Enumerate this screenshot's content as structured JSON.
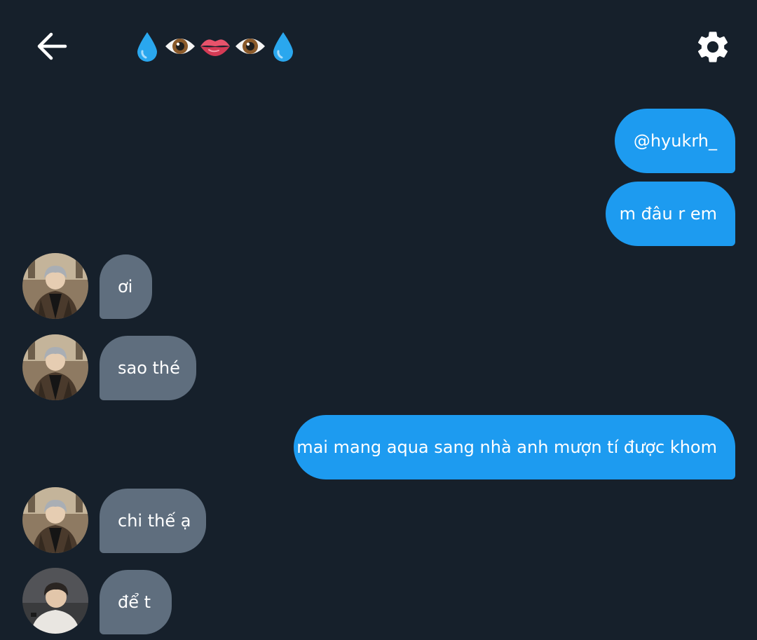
{
  "header": {
    "back_icon": "arrow-left-icon",
    "title_icons": [
      "droplet-icon",
      "eye-icon",
      "lips-icon",
      "eye-icon",
      "droplet-icon"
    ],
    "settings_icon": "gear-icon"
  },
  "colors": {
    "background": "#16202b",
    "outgoing_bubble": "#1d9bf0",
    "incoming_bubble": "#5f6e7e",
    "text": "#ffffff"
  },
  "messages": [
    {
      "direction": "out",
      "text": "@hyukrh_"
    },
    {
      "direction": "out",
      "text": "m đâu r em"
    },
    {
      "direction": "in",
      "text": "ơi",
      "avatar": "avatar-user-1"
    },
    {
      "direction": "in",
      "text": "sao thé",
      "avatar": "avatar-user-1"
    },
    {
      "direction": "out",
      "text": "mai mang aqua sang nhà anh mượn tí được khom"
    },
    {
      "direction": "in",
      "text": "chi thế ạ",
      "avatar": "avatar-user-1"
    },
    {
      "direction": "in",
      "text": "để t",
      "avatar": "avatar-user-2"
    }
  ]
}
